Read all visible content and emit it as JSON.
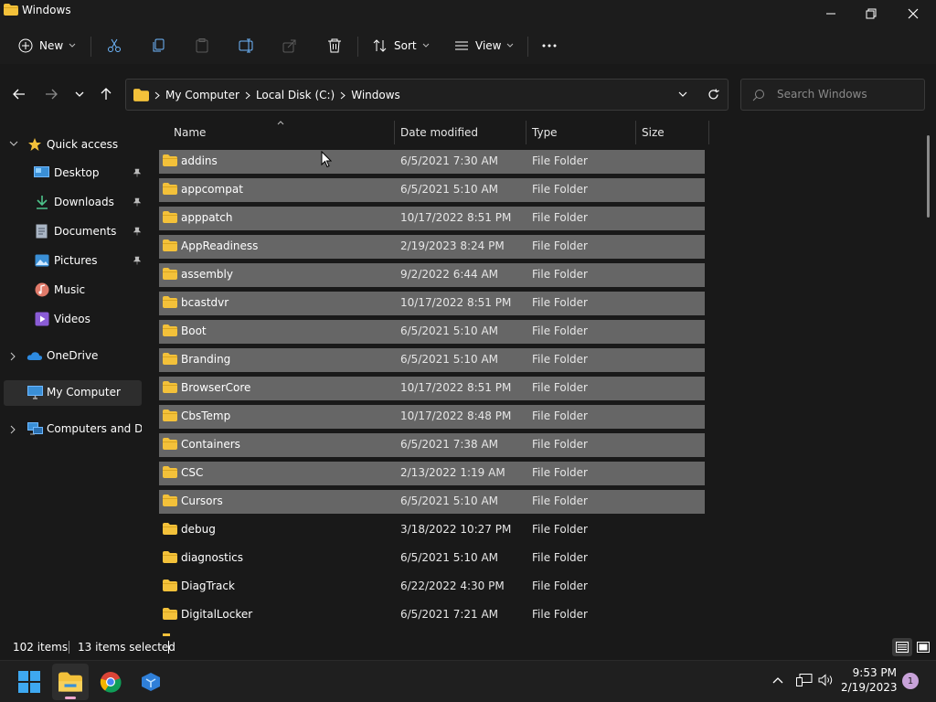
{
  "window": {
    "title": "Windows"
  },
  "toolbar": {
    "new_label": "New",
    "sort_label": "Sort",
    "view_label": "View"
  },
  "address": {
    "breadcrumbs": [
      "My Computer",
      "Local Disk (C:)",
      "Windows"
    ],
    "search_placeholder": "Search Windows"
  },
  "sidebar": {
    "quick_access": "Quick access",
    "items": [
      {
        "label": "Desktop",
        "icon": "desktop-icon",
        "pinned": true
      },
      {
        "label": "Downloads",
        "icon": "download-icon",
        "pinned": true
      },
      {
        "label": "Documents",
        "icon": "document-icon",
        "pinned": true
      },
      {
        "label": "Pictures",
        "icon": "pictures-icon",
        "pinned": true
      },
      {
        "label": "Music",
        "icon": "music-icon",
        "pinned": false
      },
      {
        "label": "Videos",
        "icon": "videos-icon",
        "pinned": false
      }
    ],
    "onedrive": "OneDrive",
    "my_computer": "My Computer",
    "network": "Computers and Devices"
  },
  "columns": {
    "name": "Name",
    "date": "Date modified",
    "type": "Type",
    "size": "Size"
  },
  "files": [
    {
      "name": "addins",
      "date": "6/5/2021 7:30 AM",
      "type": "File Folder",
      "selected": true
    },
    {
      "name": "appcompat",
      "date": "6/5/2021 5:10 AM",
      "type": "File Folder",
      "selected": true
    },
    {
      "name": "apppatch",
      "date": "10/17/2022 8:51 PM",
      "type": "File Folder",
      "selected": true
    },
    {
      "name": "AppReadiness",
      "date": "2/19/2023 8:24 PM",
      "type": "File Folder",
      "selected": true
    },
    {
      "name": "assembly",
      "date": "9/2/2022 6:44 AM",
      "type": "File Folder",
      "selected": true
    },
    {
      "name": "bcastdvr",
      "date": "10/17/2022 8:51 PM",
      "type": "File Folder",
      "selected": true
    },
    {
      "name": "Boot",
      "date": "6/5/2021 5:10 AM",
      "type": "File Folder",
      "selected": true
    },
    {
      "name": "Branding",
      "date": "6/5/2021 5:10 AM",
      "type": "File Folder",
      "selected": true
    },
    {
      "name": "BrowserCore",
      "date": "10/17/2022 8:51 PM",
      "type": "File Folder",
      "selected": true
    },
    {
      "name": "CbsTemp",
      "date": "10/17/2022 8:48 PM",
      "type": "File Folder",
      "selected": true
    },
    {
      "name": "Containers",
      "date": "6/5/2021 7:38 AM",
      "type": "File Folder",
      "selected": true
    },
    {
      "name": "CSC",
      "date": "2/13/2022 1:19 AM",
      "type": "File Folder",
      "selected": true
    },
    {
      "name": "Cursors",
      "date": "6/5/2021 5:10 AM",
      "type": "File Folder",
      "selected": true
    },
    {
      "name": "debug",
      "date": "3/18/2022 10:27 PM",
      "type": "File Folder",
      "selected": false
    },
    {
      "name": "diagnostics",
      "date": "6/5/2021 5:10 AM",
      "type": "File Folder",
      "selected": false
    },
    {
      "name": "DiagTrack",
      "date": "6/22/2022 4:30 PM",
      "type": "File Folder",
      "selected": false
    },
    {
      "name": "DigitalLocker",
      "date": "6/5/2021 7:21 AM",
      "type": "File Folder",
      "selected": false
    }
  ],
  "status": {
    "item_count": "102 items",
    "selected_count": "13 items selected"
  },
  "taskbar": {
    "time": "9:53 PM",
    "date": "2/19/2023",
    "notifications": "1"
  },
  "colors": {
    "folder": "#f3c13a",
    "selection": "#666666",
    "accent": "#60cdff"
  }
}
